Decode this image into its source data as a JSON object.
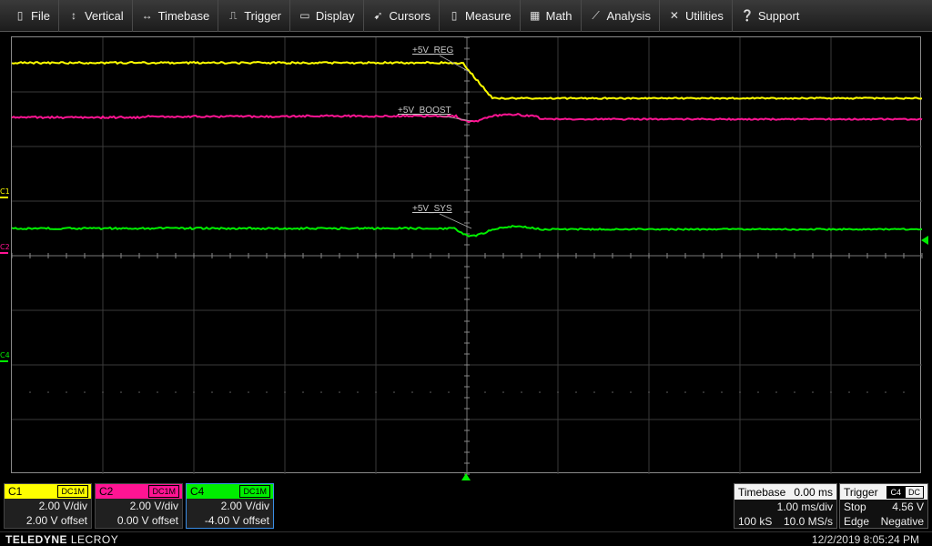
{
  "menu": [
    {
      "label": "File",
      "icon": "file-icon"
    },
    {
      "label": "Vertical",
      "icon": "vertical-arrows-icon"
    },
    {
      "label": "Timebase",
      "icon": "horizontal-arrows-icon"
    },
    {
      "label": "Trigger",
      "icon": "trigger-icon"
    },
    {
      "label": "Display",
      "icon": "display-icon"
    },
    {
      "label": "Cursors",
      "icon": "cursor-icon"
    },
    {
      "label": "Measure",
      "icon": "measure-icon"
    },
    {
      "label": "Math",
      "icon": "calculator-icon"
    },
    {
      "label": "Analysis",
      "icon": "analysis-icon"
    },
    {
      "label": "Utilities",
      "icon": "tools-icon"
    },
    {
      "label": "Support",
      "icon": "help-icon"
    }
  ],
  "waveforms": [
    {
      "label": "+5V_REG",
      "color": "#ffff00"
    },
    {
      "label": "+5V_BOOST",
      "color": "#ff1493"
    },
    {
      "label": "+5V_SYS",
      "color": "#00ee00"
    }
  ],
  "channel_markers": [
    {
      "label": "C1",
      "color": "#ffff00"
    },
    {
      "label": "C2",
      "color": "#ff1493"
    },
    {
      "label": "C4",
      "color": "#00ee00"
    }
  ],
  "channels": [
    {
      "name": "C1",
      "coupling": "DC1M",
      "vdiv": "2.00 V/div",
      "offset": "2.00 V offset",
      "color": "#ffff00"
    },
    {
      "name": "C2",
      "coupling": "DC1M",
      "vdiv": "2.00 V/div",
      "offset": "0.00 V offset",
      "color": "#ff1493"
    },
    {
      "name": "C4",
      "coupling": "DC1M",
      "vdiv": "2.00 V/div",
      "offset": "-4.00 V offset",
      "color": "#00ee00"
    }
  ],
  "timebase": {
    "title": "Timebase",
    "delay": "0.00 ms",
    "tdiv": "1.00 ms/div",
    "samples": "100 kS",
    "rate": "10.0 MS/s"
  },
  "trigger": {
    "title": "Trigger",
    "source": "C4",
    "coupling": "DC",
    "mode": "Stop",
    "level": "4.56 V",
    "type": "Edge",
    "slope": "Negative"
  },
  "brand": {
    "bold": "TELEDYNE",
    "light": "LECROY"
  },
  "clock": "12/2/2019 8:05:24 PM"
}
